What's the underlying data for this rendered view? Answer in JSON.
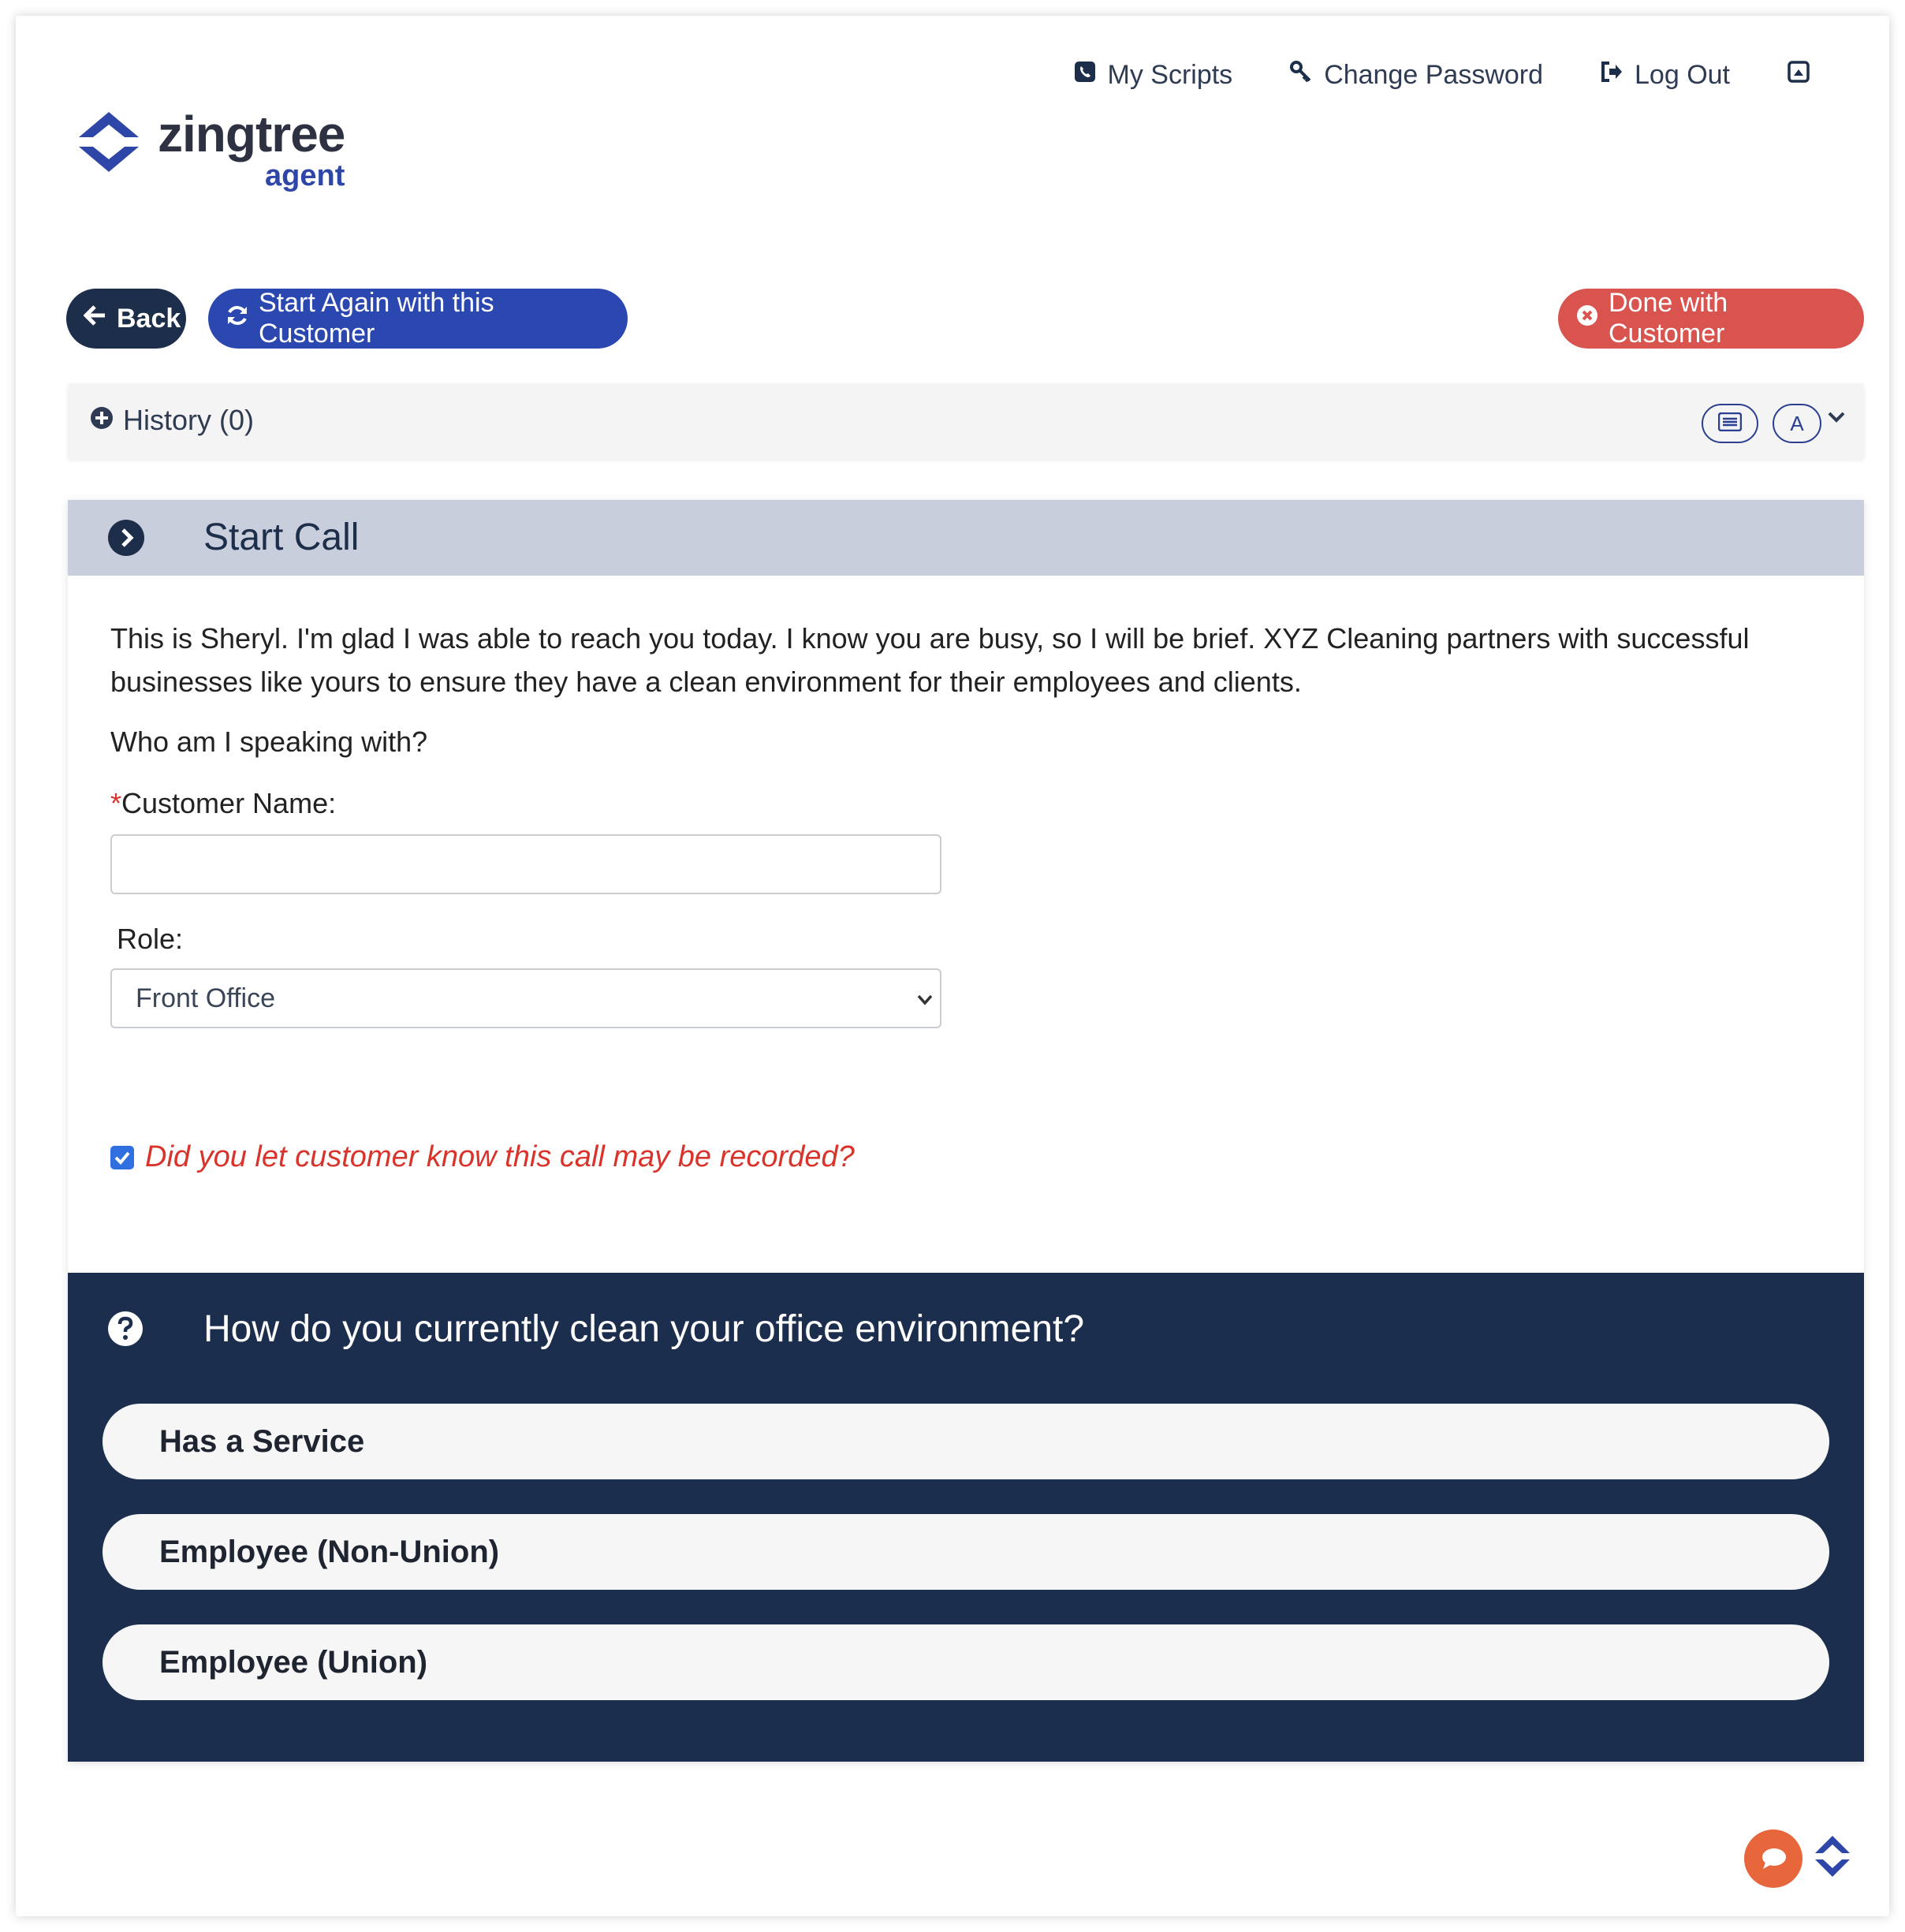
{
  "nav": {
    "my_scripts": "My Scripts",
    "change_password": "Change Password",
    "log_out": "Log Out"
  },
  "logo": {
    "word": "zingtree",
    "sub": "agent"
  },
  "actions": {
    "back": "Back",
    "restart": "Start Again with this Customer",
    "done": "Done with Customer"
  },
  "history": {
    "label": "History (0)",
    "font_toggle": "A"
  },
  "start_call": {
    "title": "Start Call",
    "body": "This is Sheryl.  I'm glad I was able to reach you today.  I know you are busy, so I will be brief. XYZ Cleaning partners with successful businesses like yours to ensure they have a clean environment for their employees and clients.",
    "question": "Who am I speaking with?",
    "required_mark": "*",
    "name_label": "Customer Name:",
    "name_value": "",
    "role_label": "Role:",
    "role_value": "Front Office",
    "recorded_label": "Did you let customer know this call may be recorded?",
    "recorded_checked": true
  },
  "question_panel": {
    "title": "How do you currently clean your office environment?",
    "options": [
      "Has a Service",
      "Employee (Non-Union)",
      "Employee (Union)"
    ]
  },
  "colors": {
    "navy": "#1c2e4d",
    "blue": "#2a48b0",
    "red": "#d9544f",
    "chat": "#e8663c"
  }
}
